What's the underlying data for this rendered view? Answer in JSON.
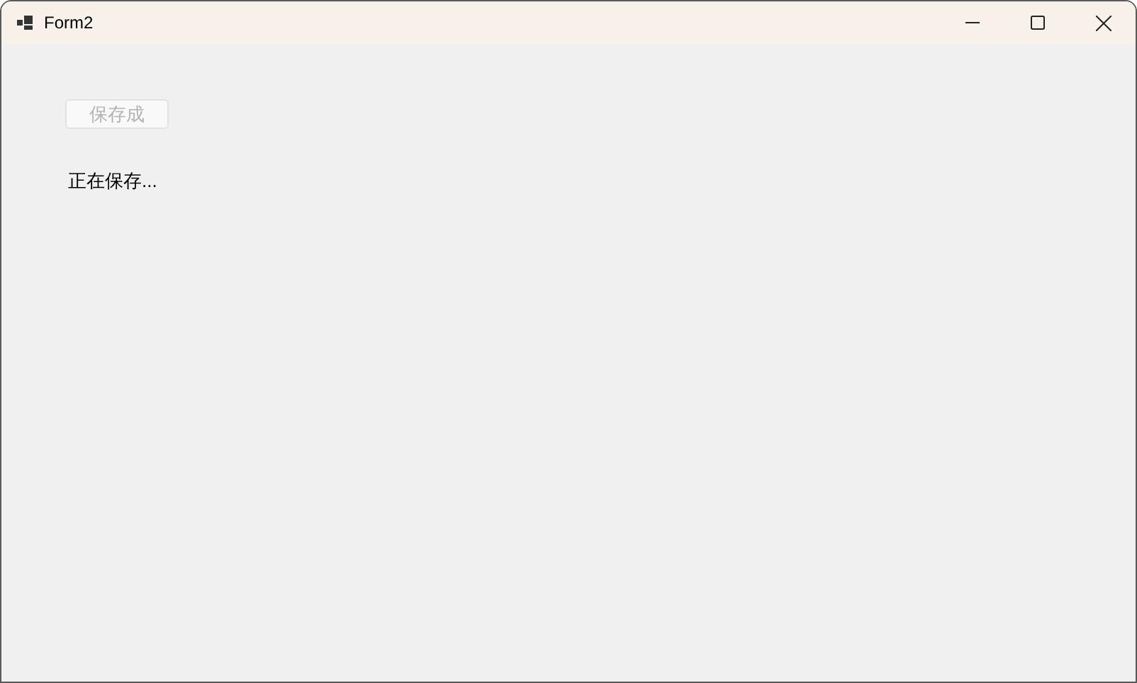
{
  "window": {
    "title": "Form2"
  },
  "save_button": {
    "label": "保存成",
    "disabled": true
  },
  "status_label": "正在保存..."
}
